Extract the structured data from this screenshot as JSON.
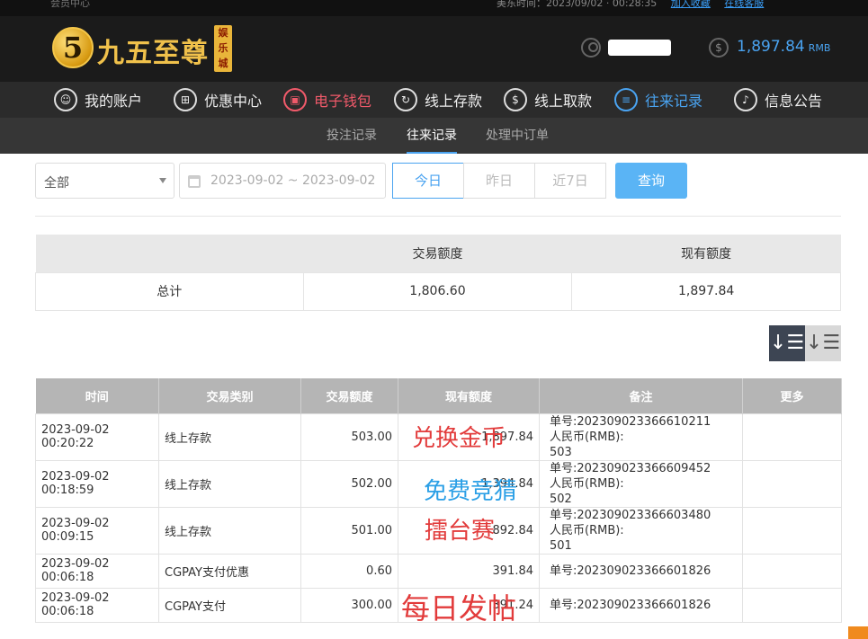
{
  "top_strip": {
    "left_text": "会员中心",
    "time_text": "美东时间：2023/09/02 · 00:28:35",
    "link1": "加入收藏",
    "link2": "在线客服"
  },
  "header": {
    "logo_text": "九五至尊",
    "logo_digit": "5",
    "logo_badge": "娱乐城",
    "balance": "1,897.84",
    "balance_unit": "RMB"
  },
  "nav": [
    {
      "label": "我的账户",
      "icon": "user-icon",
      "glyph": "☺",
      "state": "normal"
    },
    {
      "label": "优惠中心",
      "icon": "gift-icon",
      "glyph": "⊞",
      "state": "normal"
    },
    {
      "label": "电子钱包",
      "icon": "wallet-icon",
      "glyph": "▣",
      "state": "red"
    },
    {
      "label": "线上存款",
      "icon": "deposit-icon",
      "glyph": "↻",
      "state": "normal"
    },
    {
      "label": "线上取款",
      "icon": "withdraw-icon",
      "glyph": "$",
      "state": "normal"
    },
    {
      "label": "往来记录",
      "icon": "records-icon",
      "glyph": "≡",
      "state": "blue"
    },
    {
      "label": "信息公告",
      "icon": "bell-icon",
      "glyph": "♪",
      "state": "normal"
    }
  ],
  "subnav": [
    {
      "label": "投注记录",
      "active": false
    },
    {
      "label": "往来记录",
      "active": true
    },
    {
      "label": "处理中订单",
      "active": false
    }
  ],
  "filters": {
    "type_value": "全部",
    "date_range": "2023-09-02 ~ 2023-09-02",
    "quick": [
      "今日",
      "昨日",
      "近7日"
    ],
    "search_label": "查询"
  },
  "summary": {
    "headers": [
      "",
      "交易额度",
      "现有额度"
    ],
    "row": [
      "总计",
      "1,806.60",
      "1,897.84"
    ]
  },
  "sort": {
    "desc_glyph": "↓☰",
    "asc_glyph": "↓☰"
  },
  "records": {
    "headers": [
      "时间",
      "交易类别",
      "交易额度",
      "现有额度",
      "备注",
      "更多"
    ],
    "rows": [
      {
        "time": "2023-09-02 00:20:22",
        "type": "线上存款",
        "amount": "503.00",
        "balance": "1,897.84",
        "note1": "单号:202309023366610211",
        "note2": "人民币(RMB):",
        "note3": "503",
        "more": ""
      },
      {
        "time": "2023-09-02 00:18:59",
        "type": "线上存款",
        "amount": "502.00",
        "balance": "1,394.84",
        "note1": "单号:202309023366609452",
        "note2": "人民币(RMB):",
        "note3": "502",
        "more": ""
      },
      {
        "time": "2023-09-02 00:09:15",
        "type": "线上存款",
        "amount": "501.00",
        "balance": "892.84",
        "note1": "单号:202309023366603480",
        "note2": "人民币(RMB):",
        "note3": "501",
        "more": ""
      },
      {
        "time": "2023-09-02 00:06:18",
        "type": "CGPAY支付优惠",
        "amount": "0.60",
        "balance": "391.84",
        "note1": "单号:202309023366601826",
        "more": ""
      },
      {
        "time": "2023-09-02 00:06:18",
        "type": "CGPAY支付",
        "amount": "300.00",
        "balance": "391.24",
        "note1": "单号:202309023366601826",
        "more": ""
      }
    ]
  },
  "watermarks": [
    "兑换金币",
    "免费竞猜",
    "擂台赛",
    "每日发帖"
  ]
}
